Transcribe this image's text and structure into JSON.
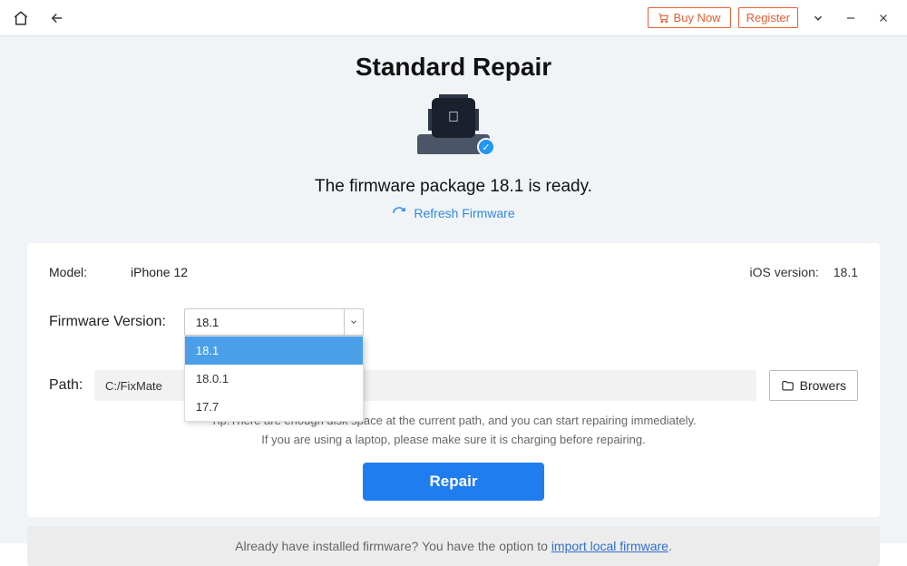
{
  "titlebar": {
    "buy_label": "Buy Now",
    "register_label": "Register"
  },
  "page_title": "Standard Repair",
  "hero": {
    "ready_text": "The firmware package 18.1 is ready.",
    "refresh_label": "Refresh Firmware"
  },
  "card": {
    "model_label": "Model:",
    "model_value": "iPhone 12",
    "ios_version_label": "iOS version:",
    "ios_version_value": "18.1",
    "fw_label": "Firmware Version:",
    "fw_selected": "18.1",
    "fw_options": [
      "18.1",
      "18.0.1",
      "17.7"
    ],
    "path_label": "Path:",
    "path_value": "C:/FixMate",
    "browse_label": "Browers",
    "tip_line1": "Tip:There are enough disk space at the current path, and you can start repairing immediately.",
    "tip_line2": "If you are using a laptop, please make sure it is charging before repairing.",
    "repair_label": "Repair"
  },
  "footer": {
    "text": "Already have installed firmware? You have the option to ",
    "link": "import local firmware",
    "period": "."
  }
}
